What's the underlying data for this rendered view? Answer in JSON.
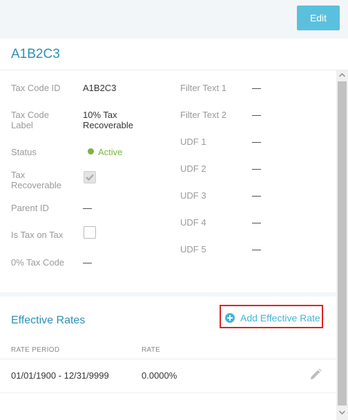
{
  "header": {
    "edit_label": "Edit",
    "title": "A1B2C3"
  },
  "details": {
    "left": [
      {
        "label": "Tax Code ID",
        "value": "A1B2C3"
      },
      {
        "label": "Tax Code Label",
        "value": "10% Tax Recoverable"
      },
      {
        "label": "Status",
        "value": "Active"
      },
      {
        "label": "Tax Recoverable",
        "checked": true
      },
      {
        "label": "Parent ID",
        "value": "—"
      },
      {
        "label": "Is Tax on Tax",
        "checked": false
      },
      {
        "label": "0% Tax Code",
        "value": "—"
      }
    ],
    "right": [
      {
        "label": "Filter Text 1",
        "value": "—"
      },
      {
        "label": "Filter Text 2",
        "value": "—"
      },
      {
        "label": "UDF 1",
        "value": "—"
      },
      {
        "label": "UDF 2",
        "value": "—"
      },
      {
        "label": "UDF 3",
        "value": "—"
      },
      {
        "label": "UDF 4",
        "value": "—"
      },
      {
        "label": "UDF 5",
        "value": "—"
      }
    ]
  },
  "rates": {
    "title": "Effective Rates",
    "add_label": "Add Effective Rate",
    "columns": [
      "RATE PERIOD",
      "RATE"
    ],
    "rows": [
      {
        "period": "01/01/1900 - 12/31/9999",
        "rate": "0.0000%"
      }
    ]
  },
  "colors": {
    "accent": "#2a8fb8",
    "button": "#5bc0de",
    "active": "#7cb342",
    "highlight": "#e02020"
  },
  "icons": [
    "plus-circle-icon",
    "pencil-icon",
    "check-icon",
    "scroll-up-icon",
    "scroll-down-icon"
  ]
}
